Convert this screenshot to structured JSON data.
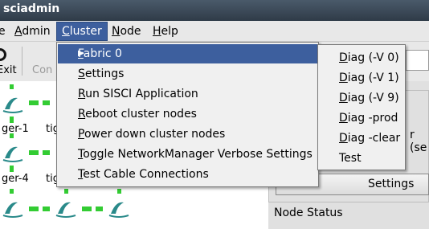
{
  "window": {
    "title": "sciadmin"
  },
  "menubar": {
    "items": [
      {
        "label": "e",
        "mnemonic": ""
      },
      {
        "label": "Admin",
        "mnemonic": "A"
      },
      {
        "label": "Cluster",
        "mnemonic": "C"
      },
      {
        "label": "Node",
        "mnemonic": "N"
      },
      {
        "label": "Help",
        "mnemonic": "H"
      }
    ]
  },
  "toolbar": {
    "exit_label": "Exit",
    "connect_label": "Con"
  },
  "cluster_menu": {
    "items": [
      {
        "pre": "",
        "ul": "F",
        "post": "abric 0",
        "has_submenu": true
      },
      {
        "pre": "",
        "ul": "S",
        "post": "ettings"
      },
      {
        "pre": "",
        "ul": "R",
        "post": "un SISCI Application"
      },
      {
        "pre": "",
        "ul": "R",
        "post": "eboot cluster nodes"
      },
      {
        "pre": "",
        "ul": "P",
        "post": "ower down cluster nodes"
      },
      {
        "pre": "",
        "ul": "T",
        "post": "oggle NetworkManager Verbose Settings"
      },
      {
        "pre": "",
        "ul": "T",
        "post": "est Cable Connections"
      }
    ]
  },
  "fabric_submenu": {
    "items": [
      {
        "ul": "D",
        "post": "iag (-V 0)"
      },
      {
        "ul": "D",
        "post": "iag (-V 1)"
      },
      {
        "ul": "D",
        "post": "iag (-V 9)"
      },
      {
        "ul": "D",
        "post": "iag -prod"
      },
      {
        "ul": "D",
        "post": "iag -clear"
      },
      {
        "ul": "",
        "post": "Test"
      }
    ]
  },
  "canvas": {
    "labels": [
      "ger-1",
      "tig",
      "ger-4",
      "tig"
    ]
  },
  "right_panel": {
    "clipped_text": "r (se",
    "settings_button": "Settings",
    "node_status": "Node Status"
  },
  "colors": {
    "highlight": "#3d5f9e",
    "link_green": "#33cc33",
    "node_icon": "#2a8a8a"
  }
}
